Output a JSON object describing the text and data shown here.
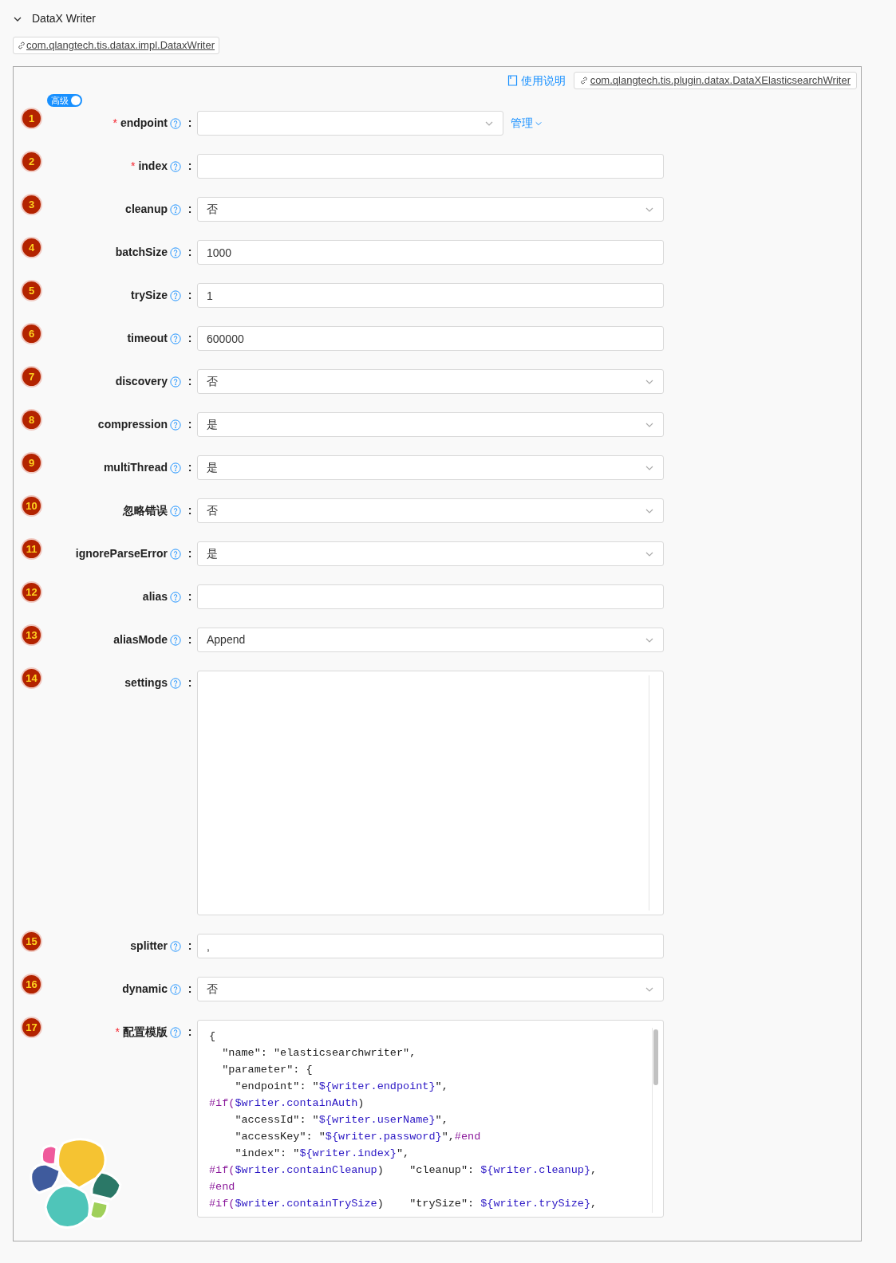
{
  "section": {
    "title": "DataX Writer",
    "expanded": true
  },
  "writer_class": "com.qlangtech.tis.datax.impl.DataxWriter",
  "doc_link": "使用说明",
  "plugin_class": "com.qlangtech.tis.plugin.datax.DataXElasticsearchWriter",
  "advanced_toggle": {
    "label": "高级",
    "on": true
  },
  "fields": [
    {
      "number": "1",
      "required_mark": "*",
      "label": "endpoint",
      "colon": ":",
      "kind": "select",
      "manage_link": "管理"
    },
    {
      "number": "2",
      "required_mark": "*",
      "label": "index",
      "colon": ":",
      "kind": "input"
    },
    {
      "number": "3",
      "label": "cleanup",
      "colon": ":",
      "kind": "select",
      "value": "否"
    },
    {
      "number": "4",
      "label": "batchSize",
      "colon": ":",
      "kind": "input",
      "value": "1000"
    },
    {
      "number": "5",
      "label": "trySize",
      "colon": ":",
      "kind": "input",
      "value": "1"
    },
    {
      "number": "6",
      "label": "timeout",
      "colon": ":",
      "kind": "input",
      "value": "600000"
    },
    {
      "number": "7",
      "label": "discovery",
      "colon": ":",
      "kind": "select",
      "value": "否"
    },
    {
      "number": "8",
      "label": "compression",
      "colon": ":",
      "kind": "select",
      "value": "是"
    },
    {
      "number": "9",
      "label": "multiThread",
      "colon": ":",
      "kind": "select",
      "value": "是"
    },
    {
      "number": "10",
      "label": "忽略错误",
      "colon": ":",
      "kind": "select",
      "value": "否"
    },
    {
      "number": "11",
      "label": "ignoreParseError",
      "colon": ":",
      "kind": "select",
      "value": "是"
    },
    {
      "number": "12",
      "label": "alias",
      "colon": ":",
      "kind": "input"
    },
    {
      "number": "13",
      "label": "aliasMode",
      "colon": ":",
      "kind": "select",
      "value": "Append"
    },
    {
      "number": "14",
      "label": "settings",
      "colon": ":",
      "kind": "textarea"
    },
    {
      "number": "15",
      "label": "splitter",
      "colon": ":",
      "kind": "input",
      "value": ","
    },
    {
      "number": "16",
      "label": "dynamic",
      "colon": ":",
      "kind": "select",
      "value": "否"
    },
    {
      "number": "17",
      "required_mark": "*",
      "label": "配置模版",
      "colon": ":",
      "kind": "code",
      "lines": [
        [
          {
            "kind": "text",
            "text": "{"
          }
        ],
        [
          {
            "kind": "text",
            "text": "  \"name\": \"elasticsearchwriter\","
          }
        ],
        [
          {
            "kind": "text",
            "text": "  \"parameter\": {"
          }
        ],
        [
          {
            "kind": "text",
            "text": "    \"endpoint\": \""
          },
          {
            "kind": "var",
            "text": "${writer.endpoint}"
          },
          {
            "kind": "text",
            "text": "\","
          }
        ],
        [
          {
            "kind": "directive",
            "text": "#if("
          },
          {
            "kind": "var",
            "text": "$writer.containAuth"
          },
          {
            "kind": "text",
            "text": ")"
          }
        ],
        [
          {
            "kind": "text",
            "text": "    \"accessId\": \""
          },
          {
            "kind": "var",
            "text": "${writer.userName}"
          },
          {
            "kind": "text",
            "text": "\","
          }
        ],
        [
          {
            "kind": "text",
            "text": "    \"accessKey\": \""
          },
          {
            "kind": "var",
            "text": "${writer.password}"
          },
          {
            "kind": "text",
            "text": "\","
          },
          {
            "kind": "directive",
            "text": "#end"
          }
        ],
        [
          {
            "kind": "text",
            "text": "    \"index\": \""
          },
          {
            "kind": "var",
            "text": "${writer.index}"
          },
          {
            "kind": "text",
            "text": "\","
          }
        ],
        [
          {
            "kind": "directive",
            "text": "#if("
          },
          {
            "kind": "var",
            "text": "$writer.containCleanup"
          },
          {
            "kind": "text",
            "text": ")    \"cleanup\": "
          },
          {
            "kind": "var",
            "text": "${writer.cleanup}"
          },
          {
            "kind": "text",
            "text": ","
          }
        ],
        [
          {
            "kind": "directive",
            "text": "#end"
          }
        ],
        [
          {
            "kind": "directive",
            "text": "#if("
          },
          {
            "kind": "var",
            "text": "$writer.containTrySize"
          },
          {
            "kind": "text",
            "text": ")    \"trySize\": "
          },
          {
            "kind": "var",
            "text": "${writer.trySize}"
          },
          {
            "kind": "text",
            "text": ","
          }
        ]
      ]
    }
  ]
}
